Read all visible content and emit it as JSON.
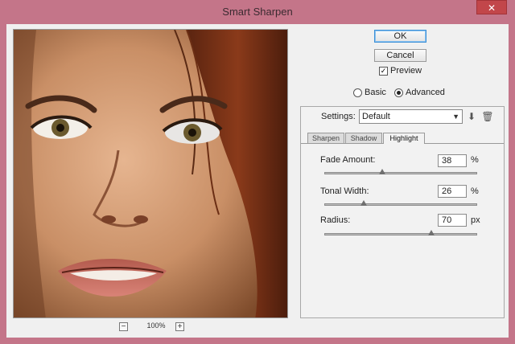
{
  "window": {
    "title": "Smart Sharpen"
  },
  "titlebar": {
    "close_glyph": "✕"
  },
  "preview": {
    "zoom_level": "100%",
    "zoom_out": "−",
    "zoom_in": "+"
  },
  "actions": {
    "ok_label": "OK",
    "cancel_label": "Cancel"
  },
  "preview_toggle": {
    "label": "Preview",
    "checked": true
  },
  "mode": {
    "basic_label": "Basic",
    "advanced_label": "Advanced",
    "selected": "Advanced"
  },
  "settings": {
    "label": "Settings:",
    "value": "Default"
  },
  "tabs": [
    {
      "label": "Sharpen"
    },
    {
      "label": "Shadow"
    },
    {
      "label": "Highlight"
    }
  ],
  "active_tab": "Highlight",
  "highlight": {
    "fade_amount": {
      "label": "Fade Amount:",
      "value": "38",
      "unit": "%",
      "level": 0.38
    },
    "tonal_width": {
      "label": "Tonal Width:",
      "value": "26",
      "unit": "%",
      "level": 0.26
    },
    "radius": {
      "label": "Radius:",
      "value": "70",
      "unit": "px",
      "level": 0.7
    }
  },
  "colors": {
    "window_frame": "#c47589",
    "dialog_bg": "#f0f0f0",
    "ok_focus": "#3c8fd6"
  }
}
